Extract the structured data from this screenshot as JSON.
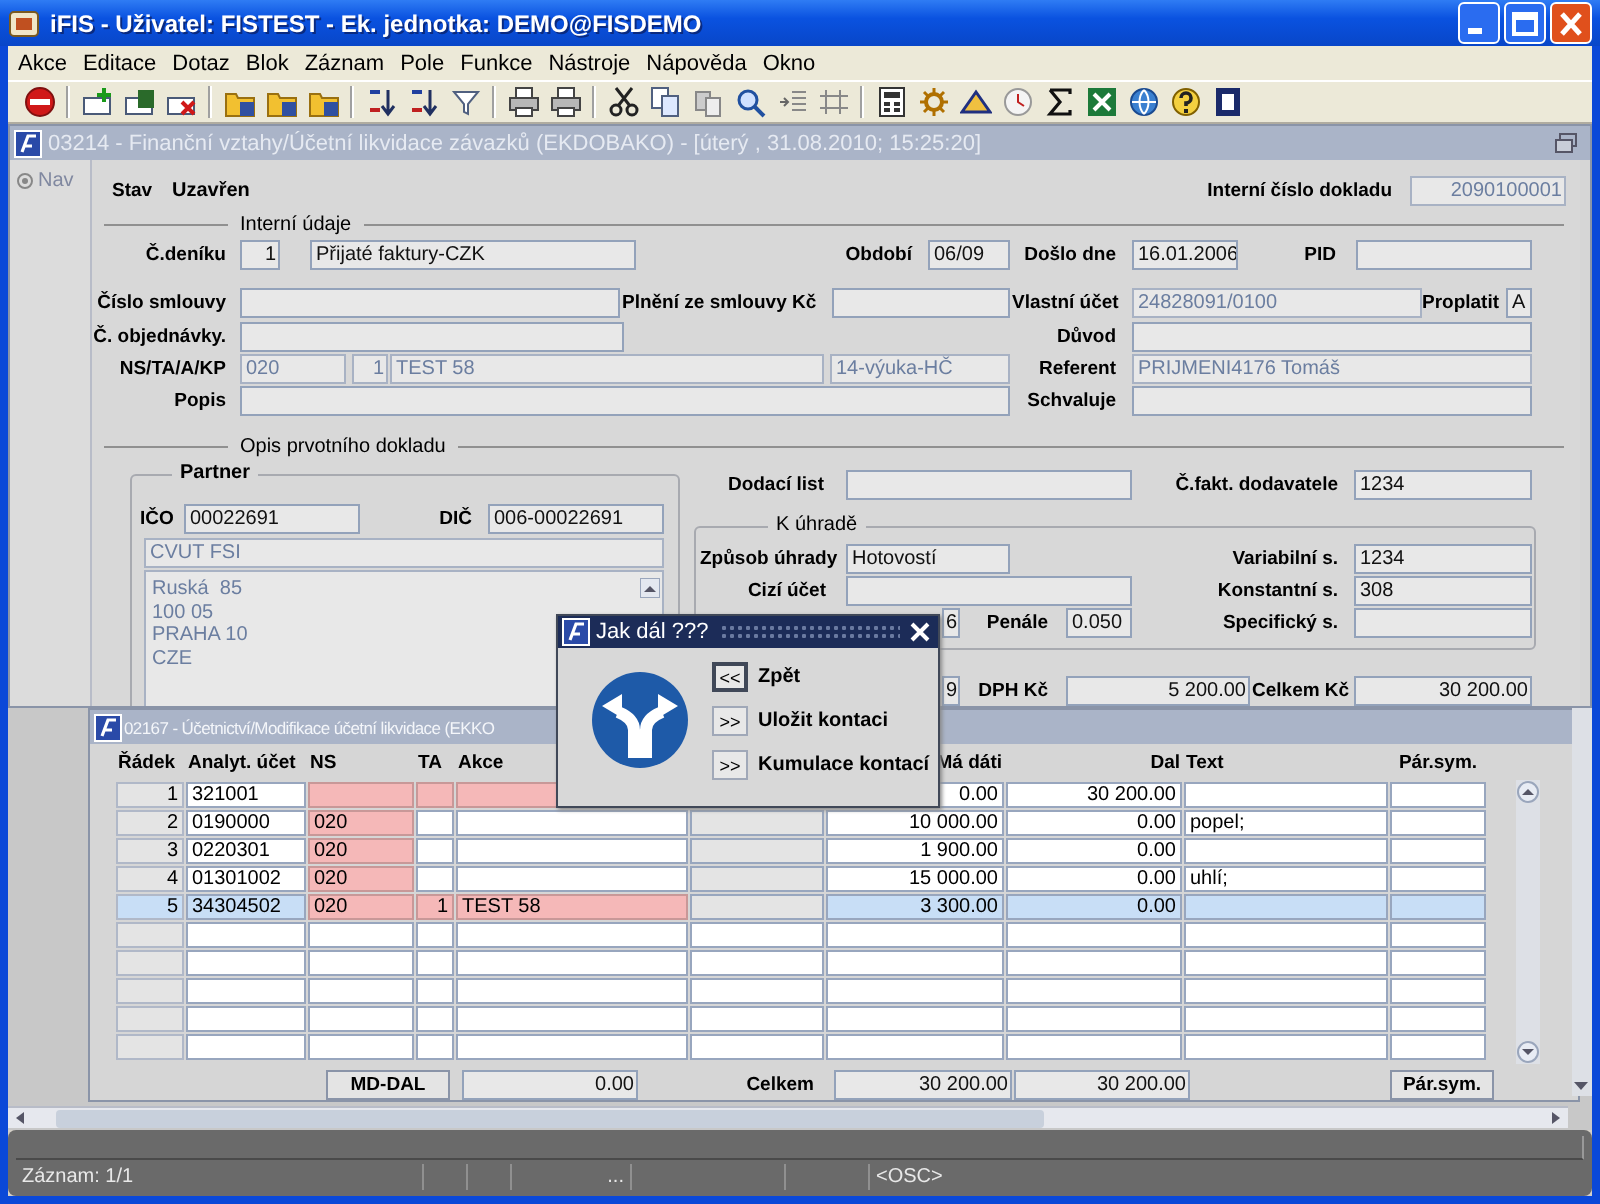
{
  "window": {
    "title": "iFIS - Uživatel: FISTEST - Ek. jednotka: DEMO@FISDEMO"
  },
  "menu": [
    "Akce",
    "Editace",
    "Dotaz",
    "Blok",
    "Záznam",
    "Pole",
    "Funkce",
    "Nástroje",
    "Nápověda",
    "Okno"
  ],
  "form_window": {
    "title": "03214 - Finanční vztahy/Účetní likvidace závazků (EKDOBAKO) - [úterý , 31.08.2010; 15:25:20]",
    "nav": "Nav",
    "header": [
      {
        "kind": "label",
        "text": "Stav"
      },
      {
        "kind": "value",
        "text": "Uzavřen"
      },
      {
        "kind": "label",
        "text": "Interní číslo dokladu"
      },
      {
        "kind": "field",
        "value": "2090100001",
        "disabled": true
      }
    ],
    "internal": {
      "title": "Interní údaje",
      "items": [
        {
          "kind": "label",
          "text": "Č.deníku"
        },
        {
          "kind": "field",
          "value": "1",
          "disabled": false
        },
        {
          "kind": "field",
          "value": "Přijaté faktury-CZK",
          "disabled": false
        },
        {
          "kind": "label",
          "text": "Období"
        },
        {
          "kind": "field",
          "value": "06/09",
          "disabled": false
        },
        {
          "kind": "label",
          "text": "Došlo dne"
        },
        {
          "kind": "field",
          "value": "16.01.2006",
          "disabled": false
        },
        {
          "kind": "label",
          "text": "PID"
        },
        {
          "kind": "field",
          "disabled": false
        },
        {
          "kind": "label",
          "text": "Číslo smlouvy"
        },
        {
          "kind": "field",
          "disabled": false
        },
        {
          "kind": "label",
          "text": "Plnění ze smlouvy Kč"
        },
        {
          "kind": "field",
          "disabled": false
        },
        {
          "kind": "label",
          "text": "Vlastní účet"
        },
        {
          "kind": "field",
          "value": "24828091/0100",
          "disabled": true
        },
        {
          "kind": "label",
          "text": "Proplatit"
        },
        {
          "kind": "field",
          "value": "A",
          "disabled": false
        },
        {
          "kind": "label",
          "text": "Č. objednávky."
        },
        {
          "kind": "field",
          "disabled": false
        },
        {
          "kind": "label",
          "text": "Důvod"
        },
        {
          "kind": "field",
          "disabled": false
        },
        {
          "kind": "label",
          "text": "NS/TA/A/KP"
        },
        {
          "kind": "field",
          "value": "020",
          "disabled": true
        },
        {
          "kind": "field",
          "value": "1",
          "disabled": true
        },
        {
          "kind": "field",
          "value": "TEST 58",
          "disabled": true
        },
        {
          "kind": "field",
          "value": "14-výuka-HČ",
          "disabled": true
        },
        {
          "kind": "label",
          "text": "Referent"
        },
        {
          "kind": "field",
          "value": "PRIJMENI4176 Tomáš",
          "disabled": true
        },
        {
          "kind": "label",
          "text": "Popis"
        },
        {
          "kind": "field",
          "disabled": false
        },
        {
          "kind": "label",
          "text": "Schvaluje"
        },
        {
          "kind": "field",
          "disabled": false
        }
      ]
    },
    "document": {
      "title": "Opis prvotního dokladu",
      "partner": {
        "title": "Partner",
        "items": [
          {
            "kind": "label",
            "text": "IČO"
          },
          {
            "kind": "field",
            "value": "00022691",
            "disabled": false
          },
          {
            "kind": "label",
            "text": "DIČ"
          },
          {
            "kind": "field",
            "value": "006-00022691",
            "disabled": false
          },
          {
            "kind": "field",
            "value": "CVUT FSI",
            "disabled": true
          }
        ],
        "address": [
          "Ruská  85",
          "100 05",
          "PRAHA 10",
          "CZE"
        ]
      },
      "delivery_row": [
        {
          "kind": "label",
          "text": "Dodací list"
        },
        {
          "kind": "field",
          "disabled": false
        },
        {
          "kind": "label",
          "text": "Č.fakt. dodavatele"
        },
        {
          "kind": "field",
          "value": "1234",
          "disabled": false
        }
      ],
      "payment": {
        "title": "K úhradě",
        "items": [
          {
            "kind": "label",
            "text": "Způsob úhrady"
          },
          {
            "kind": "field",
            "value": "Hotovostí",
            "disabled": false
          },
          {
            "kind": "label",
            "text": "Variabilní s."
          },
          {
            "kind": "field",
            "value": "1234",
            "disabled": false
          },
          {
            "kind": "label",
            "text": "Cizí účet"
          },
          {
            "kind": "field",
            "disabled": false
          },
          {
            "kind": "label",
            "text": "Konstantní s."
          },
          {
            "kind": "field",
            "value": "308",
            "disabled": false
          },
          {
            "kind": "field",
            "value": "6",
            "disabled": false
          },
          {
            "kind": "label",
            "text": "Penále"
          },
          {
            "kind": "field",
            "value": "0.050",
            "disabled": false
          },
          {
            "kind": "label",
            "text": "Specifický s."
          },
          {
            "kind": "field",
            "disabled": false
          }
        ]
      },
      "amounts_row": [
        {
          "kind": "field",
          "value": "9",
          "disabled": false
        },
        {
          "kind": "label",
          "text": "DPH Kč"
        },
        {
          "kind": "field",
          "value": "5 200.00",
          "disabled": false
        },
        {
          "kind": "label",
          "text": "Celkem Kč"
        },
        {
          "kind": "field",
          "value": "30 200.00",
          "disabled": false
        }
      ]
    }
  },
  "table_window": {
    "title": "02167 - Účetnictví/Modifikace účetní likvidace (EKKO",
    "columns": [
      {
        "label": "Řádek",
        "readonly": true
      },
      {
        "label": "Analyt. účet",
        "readonly": false
      },
      {
        "label": "NS",
        "readonly": false
      },
      {
        "label": "TA",
        "readonly": false
      },
      {
        "label": "Akce",
        "readonly": false
      },
      {
        "readonly": true
      },
      {
        "label": "Má dáti",
        "readonly": false
      },
      {
        "label": "Dal",
        "readonly": false
      },
      {
        "label": "Text",
        "readonly": false
      },
      {
        "label": "Pár.sym.",
        "readonly": false
      }
    ],
    "rows": [
      {
        "selected": false,
        "number": "1",
        "analyt_ucet": "321001",
        "ma_dati": "0.00",
        "dal": "30 200.00",
        "ns_marked": true,
        "ta_marked": true,
        "akce_marked": true
      },
      {
        "selected": false,
        "number": "2",
        "analyt_ucet": "0190000",
        "ns": "020",
        "ma_dati": "10 000.00",
        "dal": "0.00",
        "text": "popel;",
        "ns_marked": true,
        "ta_marked": false,
        "akce_marked": false
      },
      {
        "selected": false,
        "number": "3",
        "analyt_ucet": "0220301",
        "ns": "020",
        "ma_dati": "1 900.00",
        "dal": "0.00",
        "ns_marked": true,
        "ta_marked": false,
        "akce_marked": false
      },
      {
        "selected": false,
        "number": "4",
        "analyt_ucet": "01301002",
        "ns": "020",
        "ma_dati": "15 000.00",
        "dal": "0.00",
        "text": "uhlí;",
        "ns_marked": true,
        "ta_marked": false,
        "akce_marked": false
      },
      {
        "selected": true,
        "number": "5",
        "analyt_ucet": "34304502",
        "ns": "020",
        "ta": "1",
        "akce": "TEST 58",
        "ma_dati": "3 300.00",
        "dal": "0.00",
        "ns_marked": true,
        "ta_marked": true,
        "akce_marked": true
      },
      {
        "selected": false
      },
      {
        "selected": false
      },
      {
        "selected": false
      },
      {
        "selected": false
      },
      {
        "selected": false
      }
    ],
    "totals": [
      {
        "kind": "button",
        "text": "MD-DAL"
      },
      {
        "kind": "field",
        "value": "0.00",
        "disabled": false
      },
      {
        "kind": "label",
        "text": "Celkem"
      },
      {
        "kind": "field",
        "value": "30 200.00",
        "disabled": false
      },
      {
        "kind": "field",
        "value": "30 200.00",
        "disabled": false
      },
      {
        "kind": "button",
        "text": "Pár.sym."
      }
    ]
  },
  "dialog": {
    "title": "Jak dál ???",
    "options": [
      {
        "key": "<<",
        "label": "Zpět",
        "selected": true
      },
      {
        "key": ">>",
        "label": "Uložit kontaci",
        "selected": false
      },
      {
        "key": ">>",
        "label": "Kumulace kontací",
        "selected": false
      }
    ]
  },
  "status_bar": {
    "record": "Záznam: 1/1",
    "indicator": "...",
    "mode": "<OSC>"
  }
}
